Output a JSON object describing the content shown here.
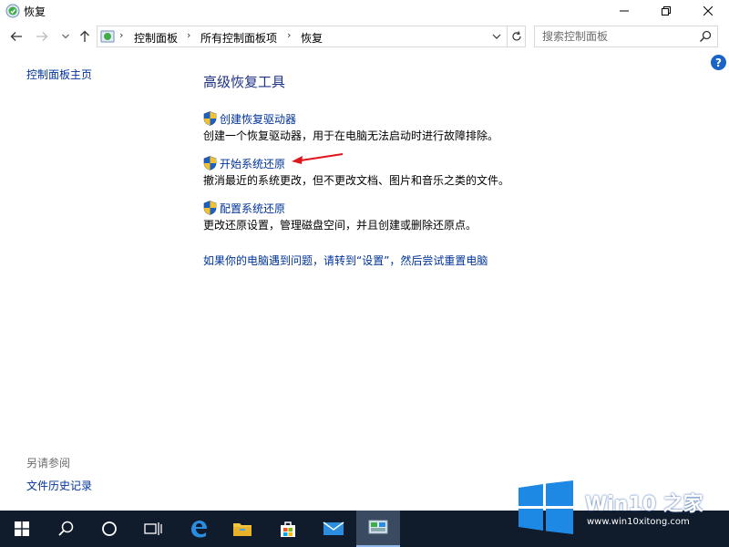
{
  "window": {
    "title": "恢复"
  },
  "nav": {
    "breadcrumbs": [
      "控制面板",
      "所有控制面板项",
      "恢复"
    ],
    "search_placeholder": "搜索控制面板"
  },
  "left_pane": {
    "home_link": "控制面板主页",
    "see_also_heading": "另请参阅",
    "see_also_links": [
      "文件历史记录"
    ]
  },
  "main": {
    "heading": "高级恢复工具",
    "tools": [
      {
        "link": "创建恢复驱动器",
        "description": "创建一个恢复驱动器，用于在电脑无法启动时进行故障排除。"
      },
      {
        "link": "开始系统还原",
        "description": "撤消最近的系统更改，但不更改文档、图片和音乐之类的文件。"
      },
      {
        "link": "配置系统还原",
        "description": "更改还原设置，管理磁盘空间，并且创建或删除还原点。"
      }
    ],
    "reset_link": "如果你的电脑遇到问题，请转到“设置”，然后尝试重置电脑"
  },
  "watermark": {
    "brand": "Win10 之家",
    "url": "www.win10xitong.com"
  },
  "colors": {
    "link": "#003399",
    "heading": "#1e3287",
    "taskbar": "#101b2b",
    "annotation_arrow": "#e0161b"
  },
  "taskbar": {
    "items": [
      "start-icon",
      "search-icon",
      "cortana-icon",
      "task-view-icon",
      "edge-icon",
      "file-explorer-icon",
      "store-icon",
      "mail-icon",
      "control-panel-icon"
    ]
  }
}
